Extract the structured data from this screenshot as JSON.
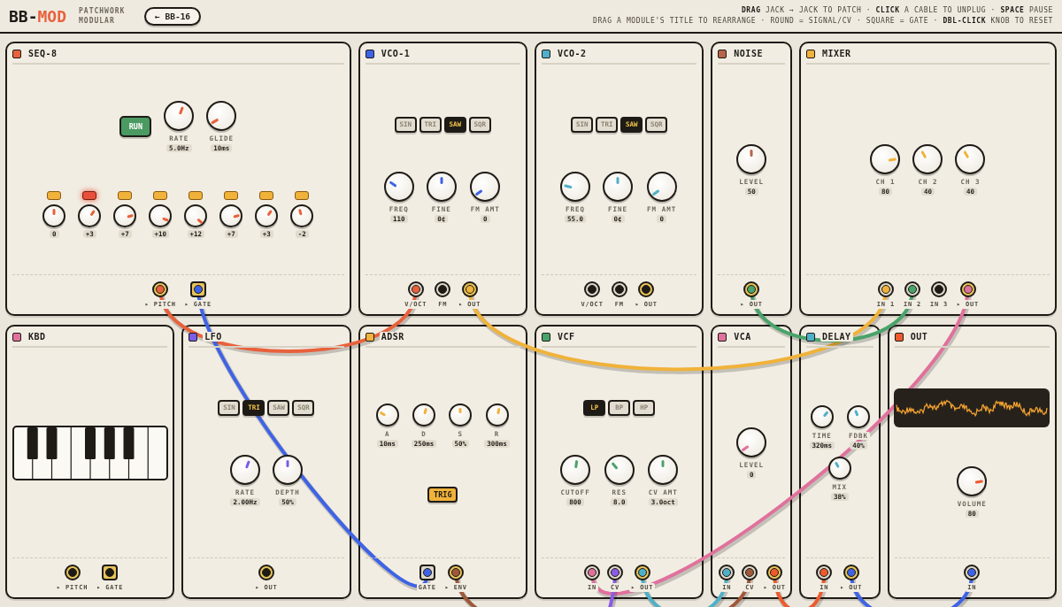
{
  "header": {
    "logo": "BB-",
    "logo_accent": "MOD",
    "subtitle": "PATCHWORK MODULAR",
    "patch_button": "← BB-16",
    "help": [
      "**DRAG** JACK → JACK TO PATCH · **CLICK** A CABLE TO UNPLUG · **SPACE** PAUSE",
      "DRAG A MODULE'S TITLE TO REARRANGE · ROUND = SIGNAL/CV · SQUARE = GATE · **DBL-CLICK** KNOB TO RESET"
    ]
  },
  "modules": [
    {
      "title": "SEQ-8",
      "color": "#e8613c",
      "rows": [
        {
          "items": [
            {
              "kind": "toggle",
              "label": "RUN",
              "on": true
            },
            {
              "kind": "knob",
              "label": "RATE",
              "value": "5.0Hz"
            },
            {
              "kind": "knob",
              "label": "GLIDE",
              "value": "10ms"
            }
          ]
        },
        {
          "items": [
            {
              "kind": "step",
              "active": false,
              "value": "0"
            },
            {
              "kind": "step",
              "active": true,
              "value": "+3"
            },
            {
              "kind": "step",
              "active": false,
              "value": "+7"
            },
            {
              "kind": "step",
              "active": false,
              "value": "+10"
            },
            {
              "kind": "step",
              "active": false,
              "value": "+12"
            },
            {
              "kind": "step",
              "active": false,
              "value": "+7"
            },
            {
              "kind": "step",
              "active": false,
              "value": "+3"
            },
            {
              "kind": "step",
              "active": false,
              "value": "-2"
            }
          ]
        }
      ],
      "jacks": [
        {
          "label": "▸ PITCH",
          "kind": "round",
          "output": true,
          "color": "#e8613c"
        },
        {
          "label": "▸ GATE",
          "kind": "square",
          "output": true,
          "color": "#3e63e6"
        }
      ]
    },
    {
      "title": "VCO-1",
      "color": "#3e63e6",
      "rows": [
        {
          "items": [
            {
              "kind": "selector",
              "options": [
                {
                  "label": "SIN",
                  "selected": false
                },
                {
                  "label": "TRI",
                  "selected": false
                },
                {
                  "label": "SAW",
                  "selected": true
                },
                {
                  "label": "SQR",
                  "selected": false
                }
              ]
            }
          ]
        },
        {
          "items": [
            {
              "kind": "knob",
              "label": "FREQ",
              "value": "110"
            },
            {
              "kind": "knob",
              "label": "FINE",
              "value": "0¢"
            },
            {
              "kind": "knob",
              "label": "FM AMT",
              "value": "0"
            }
          ]
        }
      ],
      "jacks": [
        {
          "label": "V/OCT",
          "kind": "round",
          "output": false,
          "color": "#e8613c"
        },
        {
          "label": "FM",
          "kind": "round",
          "output": false
        },
        {
          "label": "▸ OUT",
          "kind": "round",
          "output": true,
          "color": "#f0b23a"
        }
      ]
    },
    {
      "title": "VCO-2",
      "color": "#4fb0c8",
      "rows": [
        {
          "items": [
            {
              "kind": "selector",
              "options": [
                {
                  "label": "SIN",
                  "selected": false
                },
                {
                  "label": "TRI",
                  "selected": false
                },
                {
                  "label": "SAW",
                  "selected": true
                },
                {
                  "label": "SQR",
                  "selected": false
                }
              ]
            }
          ]
        },
        {
          "items": [
            {
              "kind": "knob",
              "label": "FREQ",
              "value": "55.0"
            },
            {
              "kind": "knob",
              "label": "FINE",
              "value": "0¢"
            },
            {
              "kind": "knob",
              "label": "FM AMT",
              "value": "0"
            }
          ]
        }
      ],
      "jacks": [
        {
          "label": "V/OCT",
          "kind": "round",
          "output": false
        },
        {
          "label": "FM",
          "kind": "round",
          "output": false
        },
        {
          "label": "▸ OUT",
          "kind": "round",
          "output": true
        }
      ]
    },
    {
      "title": "NOISE",
      "color": "#b5654a",
      "rows": [
        {
          "items": [
            {
              "kind": "knob",
              "label": "LEVEL",
              "value": "50"
            }
          ]
        }
      ],
      "jacks": [
        {
          "label": "▸ OUT",
          "kind": "round",
          "output": true,
          "color": "#4aa36a"
        }
      ]
    },
    {
      "title": "MIXER",
      "color": "#f0b23a",
      "rows": [
        {
          "items": [
            {
              "kind": "knob",
              "label": "CH 1",
              "value": "80"
            },
            {
              "kind": "knob",
              "label": "CH 2",
              "value": "40"
            },
            {
              "kind": "knob",
              "label": "CH 3",
              "value": "40"
            }
          ]
        }
      ],
      "jacks": [
        {
          "label": "IN 1",
          "kind": "round",
          "output": false,
          "color": "#f0b23a"
        },
        {
          "label": "IN 2",
          "kind": "round",
          "output": false,
          "color": "#4aa36a"
        },
        {
          "label": "IN 3",
          "kind": "round",
          "output": false
        },
        {
          "label": "▸ OUT",
          "kind": "round",
          "output": true,
          "color": "#e0719c"
        }
      ]
    },
    {
      "title": "KBD",
      "color": "#e0719c",
      "rows": [
        {
          "items": [
            {
              "kind": "keyboard"
            }
          ]
        }
      ],
      "jacks": [
        {
          "label": "▸ PITCH",
          "kind": "round",
          "output": true
        },
        {
          "label": "▸ GATE",
          "kind": "square",
          "output": true
        }
      ]
    },
    {
      "title": "LFO",
      "color": "#7a5ce6",
      "rows": [
        {
          "items": [
            {
              "kind": "selector",
              "options": [
                {
                  "label": "SIN",
                  "selected": false
                },
                {
                  "label": "TRI",
                  "selected": true
                },
                {
                  "label": "SAW",
                  "selected": false
                },
                {
                  "label": "SQR",
                  "selected": false
                }
              ]
            }
          ]
        },
        {
          "items": [
            {
              "kind": "knob",
              "label": "RATE",
              "value": "2.00Hz"
            },
            {
              "kind": "knob",
              "label": "DEPTH",
              "value": "50%"
            }
          ]
        }
      ],
      "jacks": [
        {
          "label": "▸ OUT",
          "kind": "round",
          "output": true
        }
      ]
    },
    {
      "title": "ADSR",
      "color": "#f0b23a",
      "rows": [
        {
          "items": [
            {
              "kind": "small-knob",
              "label": "A",
              "value": "10ms"
            },
            {
              "kind": "small-knob",
              "label": "D",
              "value": "250ms"
            },
            {
              "kind": "small-knob",
              "label": "S",
              "value": "50%"
            },
            {
              "kind": "small-knob",
              "label": "R",
              "value": "300ms"
            }
          ]
        },
        {
          "items": [
            {
              "kind": "trigger",
              "label": "TRIG"
            }
          ]
        }
      ],
      "jacks": [
        {
          "label": "GATE",
          "kind": "square",
          "output": false,
          "color": "#3e63e6"
        },
        {
          "label": "▸ ENV",
          "kind": "round",
          "output": true,
          "color": "#a0583a"
        }
      ]
    },
    {
      "title": "VCF",
      "color": "#4aa36a",
      "rows": [
        {
          "items": [
            {
              "kind": "selector",
              "options": [
                {
                  "label": "LP",
                  "selected": true
                },
                {
                  "label": "BP",
                  "selected": false
                },
                {
                  "label": "HP",
                  "selected": false
                }
              ]
            }
          ]
        },
        {
          "items": [
            {
              "kind": "knob",
              "label": "CUTOFF",
              "value": "800"
            },
            {
              "kind": "knob",
              "label": "RES",
              "value": "8.0"
            },
            {
              "kind": "knob",
              "label": "CV AMT",
              "value": "3.0oct"
            }
          ]
        }
      ],
      "jacks": [
        {
          "label": "IN",
          "kind": "round",
          "output": false,
          "color": "#e0719c"
        },
        {
          "label": "CV",
          "kind": "round",
          "output": false,
          "color": "#8a5ce6"
        },
        {
          "label": "▸ OUT",
          "kind": "round",
          "output": true,
          "color": "#4fb0c8"
        }
      ]
    },
    {
      "title": "VCA",
      "color": "#e0719c",
      "rows": [
        {
          "items": [
            {
              "kind": "knob",
              "label": "LEVEL",
              "value": "0"
            }
          ]
        }
      ],
      "jacks": [
        {
          "label": "IN",
          "kind": "round",
          "output": false,
          "color": "#4fb0c8"
        },
        {
          "label": "CV",
          "kind": "round",
          "output": false,
          "color": "#a0583a"
        },
        {
          "label": "▸ OUT",
          "kind": "round",
          "output": true,
          "color": "#ee5a2e"
        }
      ]
    },
    {
      "title": "DELAY",
      "color": "#4fb0c8",
      "rows": [
        {
          "items": [
            {
              "kind": "small-knob",
              "label": "TIME",
              "value": "320ms"
            },
            {
              "kind": "small-knob",
              "label": "FDBK",
              "value": "40%"
            },
            {
              "kind": "small-knob",
              "label": "MIX",
              "value": "38%"
            }
          ]
        }
      ],
      "jacks": [
        {
          "label": "IN",
          "kind": "round",
          "output": false,
          "color": "#ee5a2e"
        },
        {
          "label": "▸ OUT",
          "kind": "round",
          "output": true,
          "color": "#3e63e6"
        }
      ]
    },
    {
      "title": "OUT",
      "color": "#ee5a2e",
      "rows": [
        {
          "items": [
            {
              "kind": "scope"
            }
          ]
        },
        {
          "items": [
            {
              "kind": "knob",
              "label": "VOLUME",
              "value": "80"
            }
          ]
        }
      ],
      "jacks": [
        {
          "label": "IN",
          "kind": "round",
          "output": false,
          "color": "#3e63e6"
        }
      ]
    }
  ]
}
